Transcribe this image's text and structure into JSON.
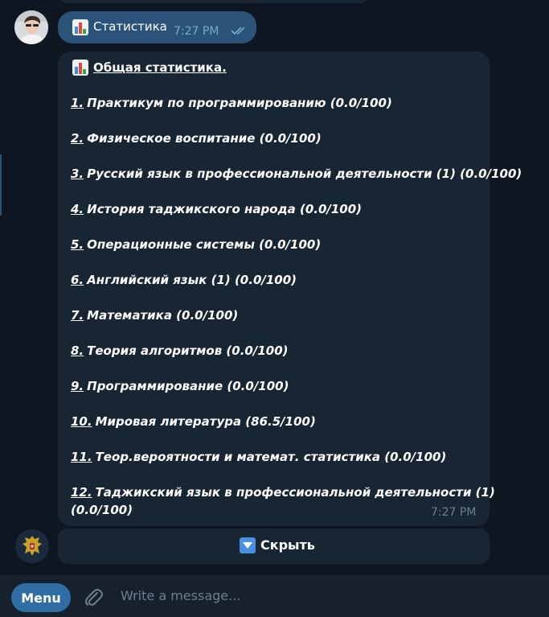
{
  "colors": {
    "app_background": "#0e1621",
    "incoming_bubble": "#182533",
    "outgoing_bubble": "#2b5278",
    "composer_background": "#17212b",
    "menu_button": "#2f6ea5",
    "accent_blue": "#4a90e2",
    "time_muted": "#6d7f8f"
  },
  "outgoing_message": {
    "icon": "bar-chart-icon",
    "text": "Статистика",
    "time": "7:27 PM",
    "status_icon": "double-check-icon"
  },
  "incoming_message": {
    "icon": "bar-chart-icon",
    "title": "Общая статистика.",
    "items": [
      {
        "num": "1.",
        "text": "Практикум по программированию (0.0/100)"
      },
      {
        "num": "2.",
        "text": "Физическое воспитание (0.0/100)"
      },
      {
        "num": "3.",
        "text": "Русский язык в профессиональной деятельности (1) (0.0/100)"
      },
      {
        "num": "4.",
        "text": "История таджикского народа (0.0/100)"
      },
      {
        "num": "5.",
        "text": "Операционные системы (0.0/100)"
      },
      {
        "num": "6.",
        "text": "Английский язык (1) (0.0/100)"
      },
      {
        "num": "7.",
        "text": "Математика (0.0/100)"
      },
      {
        "num": "8.",
        "text": "Теория алгоритмов (0.0/100)"
      },
      {
        "num": "9.",
        "text": "Программирование (0.0/100)"
      },
      {
        "num": "10.",
        "text": "Мировая литература (86.5/100)"
      },
      {
        "num": "11.",
        "text": "Теор.вероятности и математ. статистика (0.0/100)"
      },
      {
        "num": "12.",
        "text": "Таджикский язык в профессиональной деятельности (1)",
        "text_line2": "(0.0/100)"
      }
    ],
    "time": "7:27 PM"
  },
  "inline_keyboard": {
    "icon": "down-arrow-icon",
    "label": "Скрыть"
  },
  "composer": {
    "menu_label": "Menu",
    "attach_icon": "paperclip-icon",
    "placeholder": "Write a message..."
  }
}
